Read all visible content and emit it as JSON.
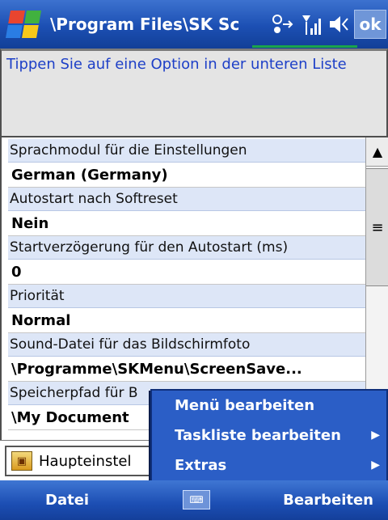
{
  "titlebar": {
    "title": "\\Program Files\\SK Sc",
    "ok_label": "ok",
    "flag_colors": [
      "#e8452f",
      "#41b13f",
      "#2a7de4",
      "#f6c81a"
    ]
  },
  "instruction": "Tippen Sie auf eine Option in der unteren Liste",
  "settings": [
    {
      "label": "Sprachmodul für die Einstellungen",
      "value": "German (Germany)"
    },
    {
      "label": "Autostart nach Softreset",
      "value": "Nein"
    },
    {
      "label": "Startverzögerung für den Autostart (ms)",
      "value": "0"
    },
    {
      "label": "Priorität",
      "value": "Normal"
    },
    {
      "label": "Sound-Datei für das Bildschirmfoto",
      "value": "\\Programme\\SKMenu\\ScreenSave..."
    },
    {
      "label": "Speicherpfad für B",
      "value": "\\My Document"
    }
  ],
  "scrollbar": {
    "up_glyph": "▲",
    "thumb_glyph": "≡"
  },
  "combo": {
    "label": "Haupteinstel"
  },
  "menu": {
    "items": [
      {
        "label": "Menü bearbeiten",
        "has_submenu": false
      },
      {
        "label": "Taskliste bearbeiten",
        "has_submenu": true
      },
      {
        "label": "Extras",
        "has_submenu": true
      }
    ],
    "submenu_glyph": "▶"
  },
  "softkeys": {
    "left": "Datei",
    "right": "Bearbeiten",
    "keyboard_glyph": "⌨"
  },
  "colors": {
    "accent": "#2b5ec6",
    "label_bg": "#dde6f7",
    "instruction_text": "#1d3fc7"
  }
}
